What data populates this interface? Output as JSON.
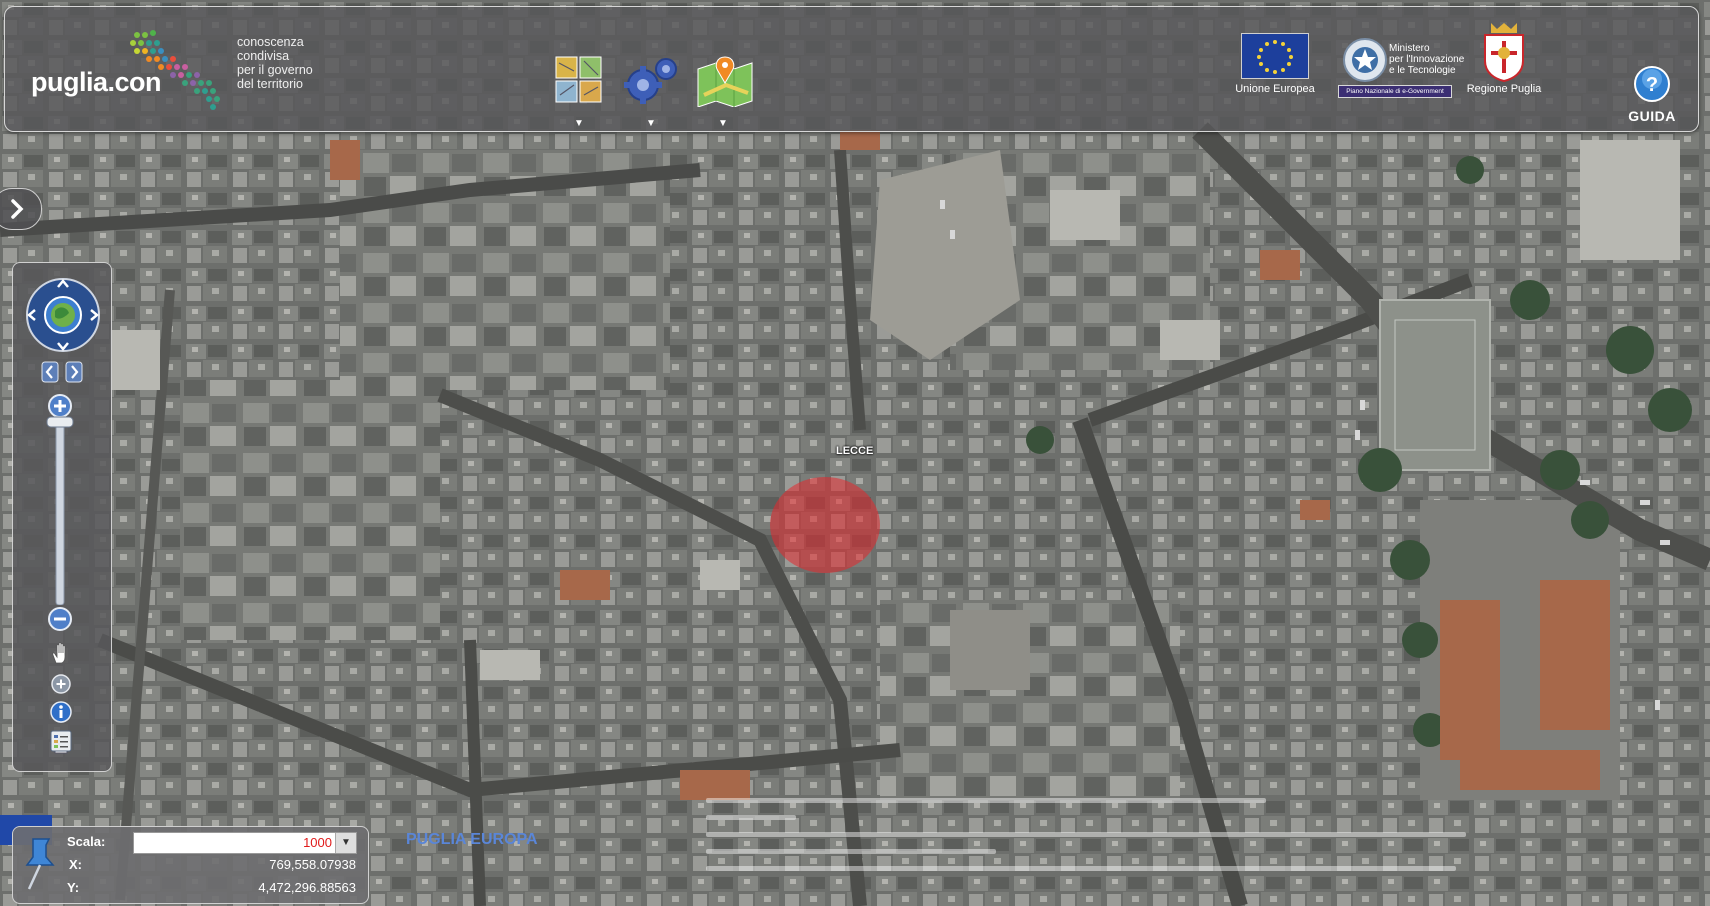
{
  "header": {
    "logo_text": "puglia.con",
    "logo_subtitle": [
      "conoscenza",
      "condivisa",
      "per il governo",
      "del territorio"
    ],
    "tools": [
      {
        "icon": "layers-icon",
        "arrow": "▼"
      },
      {
        "icon": "gears-icon",
        "arrow": "▼"
      },
      {
        "icon": "map-pin-icon",
        "arrow": "▼"
      }
    ],
    "eu_caption": "Unione Europea",
    "ministry_caption": [
      "Ministero",
      "per l'Innovazione",
      "e le Tecnologie"
    ],
    "ministry_bar": "Piano Nazionale di e-Government",
    "region_caption": "Regione Puglia",
    "guida_label": "GUIDA",
    "guida_glyph": "?"
  },
  "map": {
    "place_label": "LECCE",
    "marker_color": "#e6282d"
  },
  "coords": {
    "scale_label": "Scala:",
    "scale_value": "1000",
    "x_label": "X:",
    "x_value": "769,558.07938",
    "y_label": "Y:",
    "y_value": "4,472,296.88563"
  },
  "footer": {
    "puglia_europa": "PUGLIA EUROPA"
  },
  "colors": {
    "header_bg": "#58585a",
    "accent_blue": "#1d3f9c",
    "scale_value": "#e01b1b"
  }
}
